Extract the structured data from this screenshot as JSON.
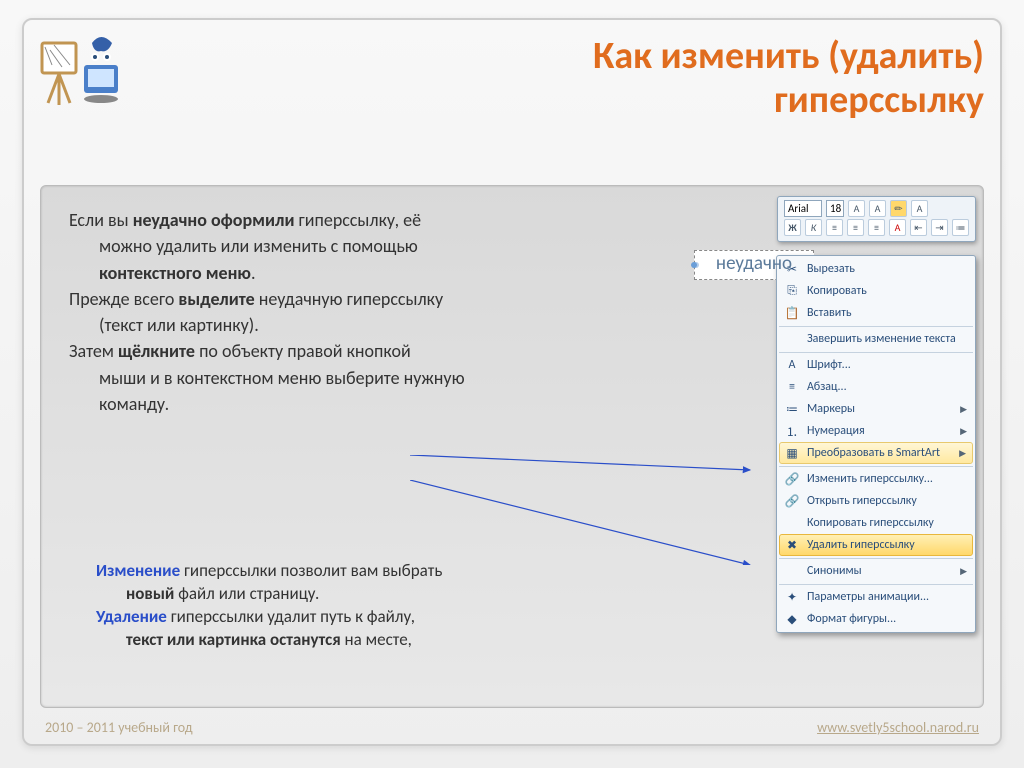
{
  "title_l1": "Как изменить (удалить)",
  "title_l2": "гиперссылку",
  "para": {
    "p1a": "Если вы ",
    "p1b": "неудачно оформили ",
    "p1c": "гиперссылку, её",
    "p2": "можно удалить или изменить с помощью",
    "p3": "контекстного меню",
    "p4a": "Прежде всего ",
    "p4b": "выделите ",
    "p4c": "неудачную гиперссылку",
    "p5": "(текст или картинку).",
    "p6a": "Затем ",
    "p6b": "щёлкните ",
    "p6c": "по объекту правой кнопкой",
    "p7": "мыши и в контекстном меню выберите нужную",
    "p8": "команду."
  },
  "bottom": {
    "b1a": "Изменение ",
    "b1b": "гиперссылки позволит вам выбрать",
    "b2a": "новый ",
    "b2b": "файл или страницу.",
    "b3a": "Удаление ",
    "b3b": "гиперссылки удалит путь к файлу,",
    "b4a": "текст или картинка останутся ",
    "b4b": "на месте,"
  },
  "footer_year": "2010 – 2011 учебный год",
  "footer_url": "www.svetly5school.narod.ru",
  "toolbar": {
    "font": "Arial",
    "size": "18"
  },
  "selected_word": "неудачно",
  "menu": [
    {
      "label": "Вырезать",
      "ico": "✂"
    },
    {
      "label": "Копировать",
      "ico": "⎘"
    },
    {
      "label": "Вставить",
      "ico": "📋"
    },
    {
      "label": "Завершить изменение текста",
      "sep": true
    },
    {
      "label": "Шрифт...",
      "ico": "A",
      "sep": true
    },
    {
      "label": "Абзац...",
      "ico": "≡"
    },
    {
      "label": "Маркеры",
      "ico": "≔",
      "sub": true
    },
    {
      "label": "Нумерация",
      "ico": "⒈",
      "sub": true
    },
    {
      "label": "Преобразовать в SmartArt",
      "ico": "▦",
      "sub": true,
      "hl": "hl2"
    },
    {
      "label": "Изменить гиперссылку...",
      "ico": "🔗",
      "sep": true
    },
    {
      "label": "Открыть гиперссылку",
      "ico": "🔗"
    },
    {
      "label": "Копировать гиперссылку"
    },
    {
      "label": "Удалить гиперссылку",
      "ico": "✖",
      "hl": "hl"
    },
    {
      "label": "Синонимы",
      "sub": true,
      "sep": true
    },
    {
      "label": "Параметры анимации...",
      "ico": "✦",
      "sep": true
    },
    {
      "label": "Формат фигуры...",
      "ico": "◆"
    }
  ]
}
